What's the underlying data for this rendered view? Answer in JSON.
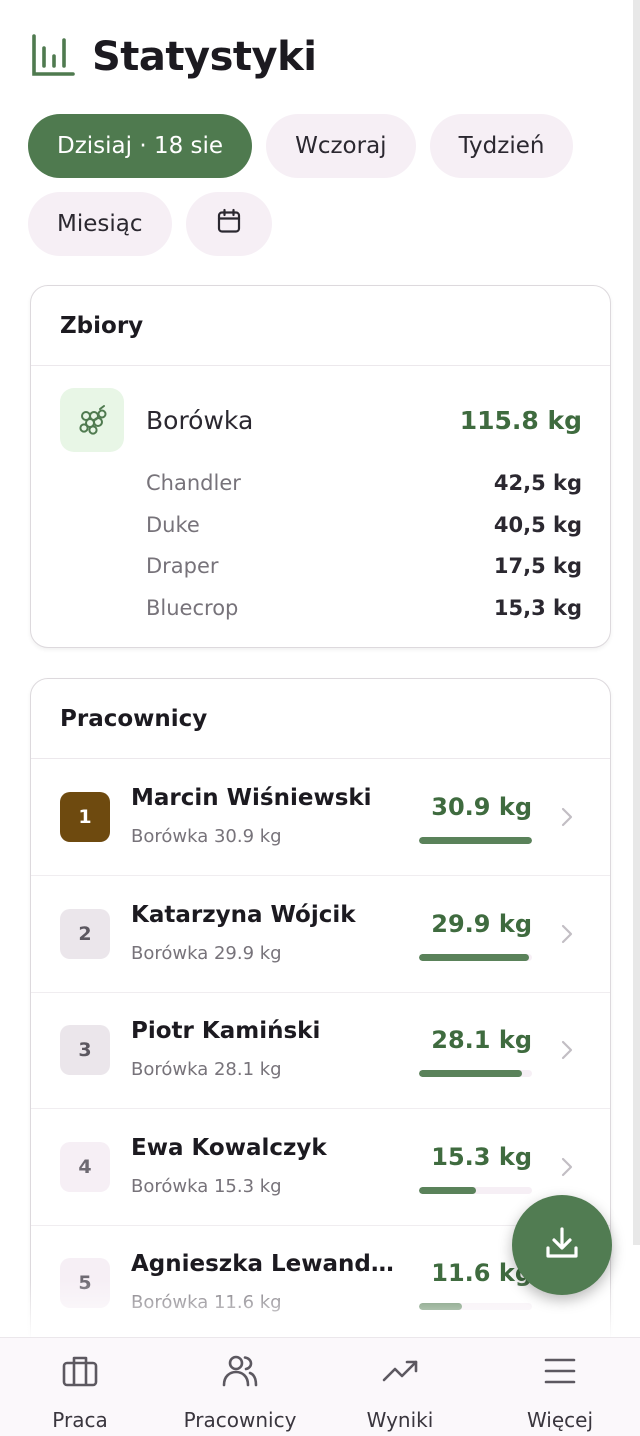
{
  "header": {
    "title": "Statystyki",
    "icon": "bar-chart-icon"
  },
  "filters": {
    "today": "Dzisiaj · 18 sie",
    "yesterday": "Wczoraj",
    "week": "Tydzień",
    "month": "Miesiąc",
    "calendar_icon": "calendar-icon",
    "active": "today"
  },
  "harvest": {
    "title": "Zbiory",
    "crop": {
      "name": "Borówka",
      "total": "115.8 kg",
      "icon": "grape-icon"
    },
    "varieties": [
      {
        "name": "Chandler",
        "value": "42,5 kg"
      },
      {
        "name": "Duke",
        "value": "40,5 kg"
      },
      {
        "name": "Draper",
        "value": "17,5 kg"
      },
      {
        "name": "Bluecrop",
        "value": "15,3 kg"
      }
    ]
  },
  "workers": {
    "title": "Pracownicy",
    "rows": [
      {
        "rank": "1",
        "name": "Marcin Wiśniewski",
        "detail": "Borówka 30.9 kg",
        "total": "30.9 kg",
        "share": 1.0
      },
      {
        "rank": "2",
        "name": "Katarzyna Wójcik",
        "detail": "Borówka 29.9 kg",
        "total": "29.9 kg",
        "share": 0.97
      },
      {
        "rank": "3",
        "name": "Piotr Kamiński",
        "detail": "Borówka 28.1 kg",
        "total": "28.1 kg",
        "share": 0.91
      },
      {
        "rank": "4",
        "name": "Ewa Kowalczyk",
        "detail": "Borówka 15.3 kg",
        "total": "15.3 kg",
        "share": 0.5
      },
      {
        "rank": "5",
        "name": "Agnieszka Lewando...",
        "detail": "Borówka 11.6 kg",
        "total": "11.6 kg",
        "share": 0.38
      }
    ]
  },
  "fab": {
    "icon": "download-icon"
  },
  "nav": {
    "items": [
      {
        "label": "Praca",
        "icon": "briefcase-icon"
      },
      {
        "label": "Pracownicy",
        "icon": "users-icon"
      },
      {
        "label": "Wyniki",
        "icon": "trending-up-icon"
      },
      {
        "label": "Więcej",
        "icon": "menu-icon"
      }
    ]
  },
  "colors": {
    "accent": "#4f7a4f",
    "chip_bg": "#f6eff5",
    "kg_green": "#3f6b3f",
    "gold_rank": "#6e4a0f"
  }
}
